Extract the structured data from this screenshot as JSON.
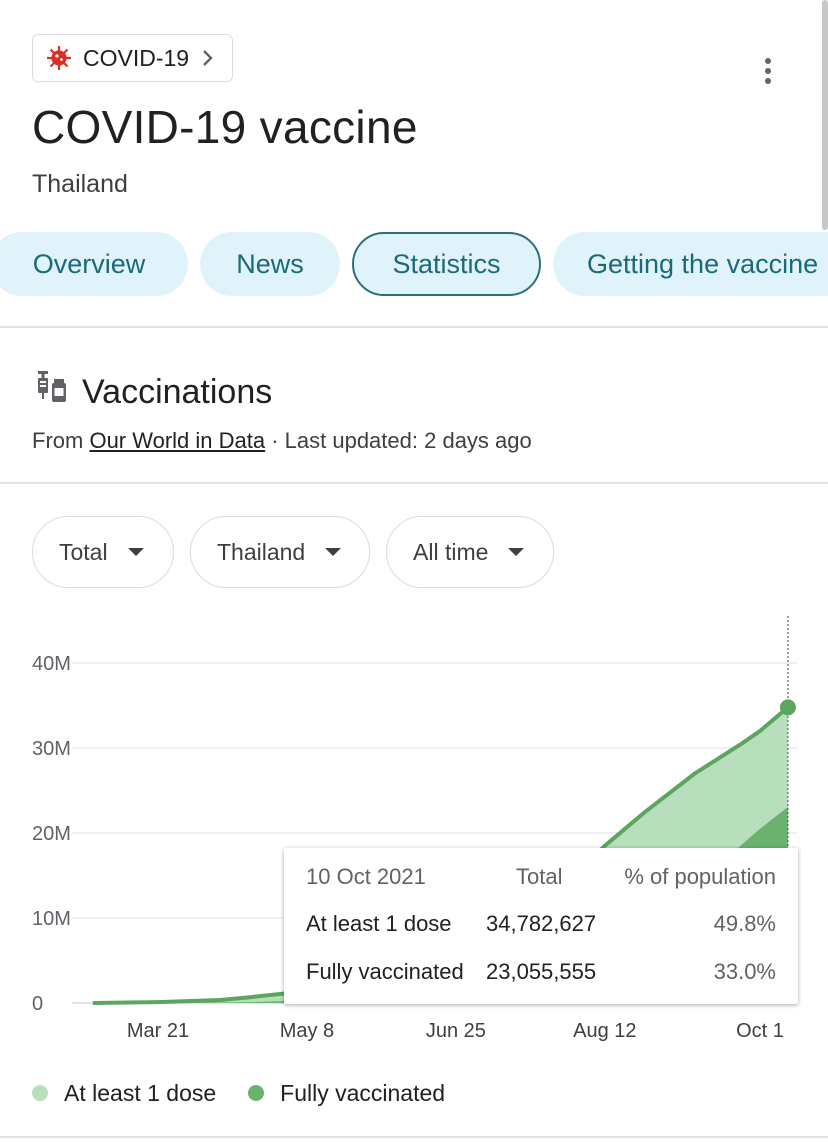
{
  "topic_chip": {
    "label": "COVID-19",
    "icon": "virus-icon",
    "icon_color": "#d93025"
  },
  "header": {
    "title": "COVID-19 vaccine",
    "subtitle": "Thailand"
  },
  "tabs": [
    {
      "label": "Overview"
    },
    {
      "label": "News"
    },
    {
      "label": "Statistics",
      "active": true
    },
    {
      "label": "Getting the vaccine"
    }
  ],
  "section": {
    "title": "Vaccinations",
    "source_prefix": "From ",
    "source_link": "Our World in Data",
    "source_suffix": " · Last updated: 2 days ago"
  },
  "filters": [
    {
      "label": "Total"
    },
    {
      "label": "Thailand"
    },
    {
      "label": "All time"
    }
  ],
  "colors": {
    "first_dose": "#b7dfbb",
    "fully": "#6bb26f",
    "line": "#5aa65e",
    "accent_teal": "#1a6a78"
  },
  "chart_data": {
    "type": "area",
    "y_ticks": [
      "0",
      "10M",
      "20M",
      "30M",
      "40M"
    ],
    "ylim": [
      0,
      45000000
    ],
    "x_tick_labels": [
      "Mar 21",
      "May 8",
      "Jun 25",
      "Aug 12",
      "Oct 1"
    ],
    "x_tick_dates": [
      "2021-03-21",
      "2021-05-08",
      "2021-06-25",
      "2021-08-12",
      "2021-10-01"
    ],
    "series": [
      {
        "name": "At least 1 dose",
        "points": [
          [
            "2021-02-28",
            0
          ],
          [
            "2021-03-21",
            100000
          ],
          [
            "2021-04-10",
            350000
          ],
          [
            "2021-04-20",
            700000
          ],
          [
            "2021-05-08",
            1400000
          ],
          [
            "2021-05-20",
            2200000
          ],
          [
            "2021-06-01",
            3400000
          ],
          [
            "2021-06-15",
            5000000
          ],
          [
            "2021-06-25",
            6500000
          ],
          [
            "2021-07-15",
            10500000
          ],
          [
            "2021-08-01",
            14500000
          ],
          [
            "2021-08-12",
            18500000
          ],
          [
            "2021-08-25",
            22500000
          ],
          [
            "2021-09-10",
            27000000
          ],
          [
            "2021-09-25",
            30500000
          ],
          [
            "2021-10-01",
            32000000
          ],
          [
            "2021-10-10",
            34782627
          ]
        ]
      },
      {
        "name": "Fully vaccinated",
        "points": [
          [
            "2021-02-28",
            0
          ],
          [
            "2021-03-21",
            0
          ],
          [
            "2021-04-20",
            100000
          ],
          [
            "2021-05-08",
            300000
          ],
          [
            "2021-06-01",
            800000
          ],
          [
            "2021-06-25",
            1500000
          ],
          [
            "2021-07-15",
            3000000
          ],
          [
            "2021-08-12",
            6500000
          ],
          [
            "2021-09-01",
            11000000
          ],
          [
            "2021-09-20",
            17000000
          ],
          [
            "2021-10-01",
            20500000
          ],
          [
            "2021-10-10",
            23055555
          ]
        ]
      }
    ],
    "tooltip": {
      "date": "10 Oct 2021",
      "col_total": "Total",
      "col_pct": "% of population",
      "rows": [
        {
          "label": "At least 1 dose",
          "total": "34,782,627",
          "pct": "49.8%"
        },
        {
          "label": "Fully vaccinated",
          "total": "23,055,555",
          "pct": "33.0%"
        }
      ]
    },
    "legend": [
      "At least 1 dose",
      "Fully vaccinated"
    ]
  }
}
